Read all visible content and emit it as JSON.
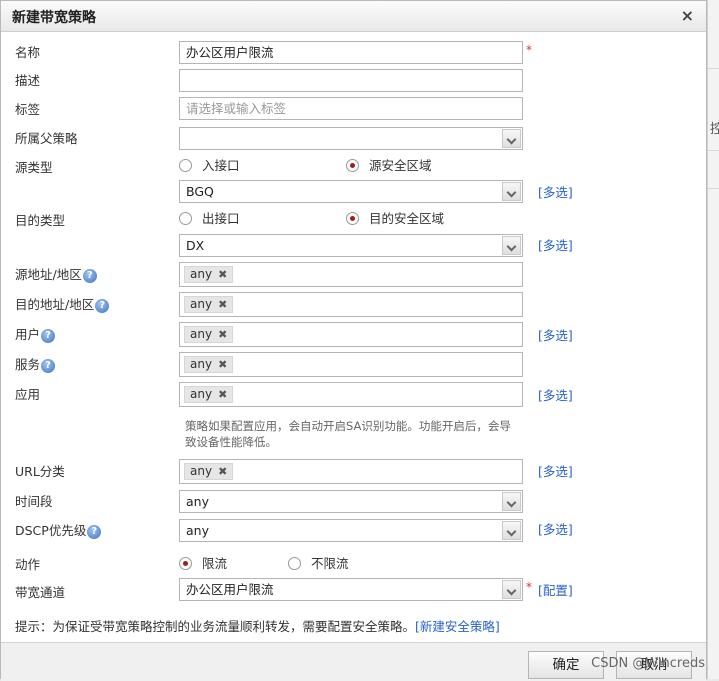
{
  "dialog": {
    "title": "新建带宽策略",
    "close": "×"
  },
  "name": {
    "label": "名称",
    "value": "办公区用户限流",
    "required": "*"
  },
  "desc": {
    "label": "描述",
    "value": ""
  },
  "tags": {
    "label": "标签",
    "placeholder": "请选择或输入标签"
  },
  "parent": {
    "label": "所属父策略",
    "value": ""
  },
  "src_type": {
    "label": "源类型",
    "opt1": "入接口",
    "opt2": "源安全区域",
    "selected": "源安全区域",
    "zone": "BGQ",
    "multi": "[多选]"
  },
  "dst_type": {
    "label": "目的类型",
    "opt1": "出接口",
    "opt2": "目的安全区域",
    "selected": "目的安全区域",
    "zone": "DX",
    "multi": "[多选]"
  },
  "src_addr": {
    "label": "源地址/地区",
    "tag": "any"
  },
  "dst_addr": {
    "label": "目的地址/地区",
    "tag": "any"
  },
  "user": {
    "label": "用户",
    "tag": "any",
    "multi": "[多选]"
  },
  "service": {
    "label": "服务",
    "tag": "any"
  },
  "app": {
    "label": "应用",
    "tag": "any",
    "multi": "[多选]",
    "note": "策略如果配置应用，会自动开启SA识别功能。功能开启后，会导致设备性能降低。"
  },
  "url": {
    "label": "URL分类",
    "tag": "any",
    "multi": "[多选]"
  },
  "time": {
    "label": "时间段",
    "value": "any"
  },
  "dscp": {
    "label": "DSCP优先级",
    "value": "any",
    "multi": "[多选]"
  },
  "action": {
    "label": "动作",
    "opt1": "限流",
    "opt2": "不限流",
    "selected": "限流"
  },
  "channel": {
    "label": "带宽通道",
    "value": "办公区用户限流",
    "required": "*",
    "config": "[配置]"
  },
  "hint": {
    "text": "提示：为保证受带宽策略控制的业务流量顺利转发，需要配置安全策略。",
    "link": "[新建安全策略]"
  },
  "footer": {
    "ok": "确定",
    "cancel": "取消"
  },
  "help_glyph": "?",
  "tag_remove_glyph": "✖",
  "sidebar_fragment": "控",
  "watermark": "CSDN @Wincreds",
  "colors": {
    "link": "#2962c9",
    "radio_on": "#a31c1c",
    "required": "#dd3333"
  }
}
